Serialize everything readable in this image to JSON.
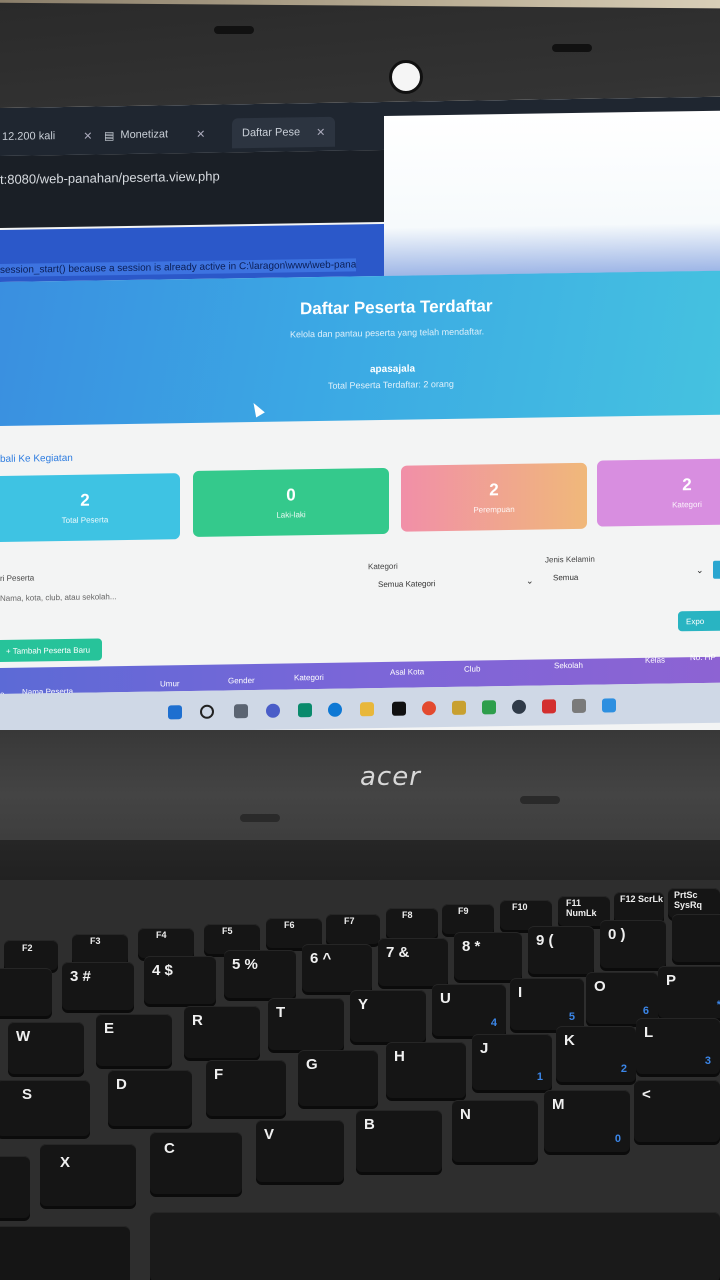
{
  "browser": {
    "tabs": [
      {
        "label": "12.200 kali"
      },
      {
        "label": "Monetizat"
      },
      {
        "label": "Daftar Pese"
      }
    ],
    "url": "t:8080/web-panahan/peserta.view.php"
  },
  "warning_text": "session_start() because a session is already active in C:\\laragon\\www\\web-pana",
  "hero": {
    "title": "Daftar Peserta Terdaftar",
    "subtitle": "Kelola dan pantau peserta yang telah mendaftar.",
    "user": "apasajala",
    "total": "Total Peserta Terdaftar: 2 orang"
  },
  "back_link": "bali Ke Kegiatan",
  "stats": [
    {
      "value": "2",
      "label": "Total Peserta"
    },
    {
      "value": "0",
      "label": "Laki-laki"
    },
    {
      "value": "2",
      "label": "Perempuan"
    },
    {
      "value": "2",
      "label": "Kategori"
    }
  ],
  "filters": {
    "search_label": "ri Peserta",
    "search_placeholder": "Nama, kota, club, atau sekolah...",
    "category_label": "Kategori",
    "category_value": "Semua Kategori",
    "gender_label": "Jenis Kelamin",
    "gender_value": "Semua"
  },
  "buttons": {
    "add": "+ Tambah Peserta Baru",
    "export": "Expo"
  },
  "table_headers": [
    "o",
    "Nama Peserta",
    "Umur",
    "Gender",
    "Kategori",
    "Asal Kota",
    "Club",
    "Sekolah",
    "Kelas",
    "No. HP"
  ],
  "laptop": {
    "brand": "acer"
  },
  "keyboard": {
    "fn_row": [
      "F2",
      "F3",
      "F4",
      "F5",
      "F6",
      "F7",
      "F8",
      "F9",
      "F10",
      "F11 NumLk",
      "F12 ScrLk",
      "PrtSc SysRq"
    ],
    "number_row": [
      "3 #",
      "4 $",
      "5 %",
      "6 ^",
      "7 &",
      "8 *",
      "9 (",
      "0 )"
    ],
    "top_letters": [
      "W",
      "E",
      "R",
      "T",
      "Y",
      "U",
      "I",
      "O",
      "P"
    ],
    "mid_letters": [
      "S",
      "D",
      "F",
      "G",
      "H",
      "J",
      "K",
      "L"
    ],
    "bottom_letters": [
      "X",
      "C",
      "V",
      "B",
      "N",
      "M"
    ]
  }
}
